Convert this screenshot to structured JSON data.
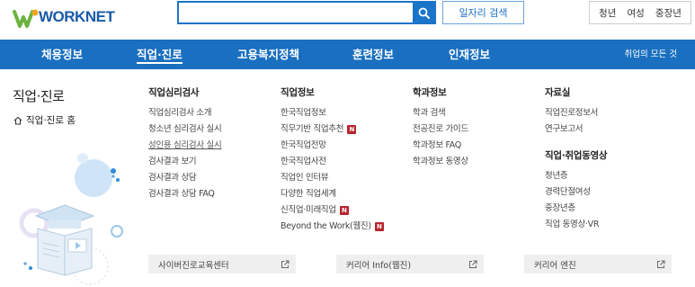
{
  "header": {
    "logo_text": "WORKNET",
    "search_placeholder": "",
    "job_search_label": "일자리 검색",
    "group_tabs": [
      "청년",
      "여성",
      "중장년"
    ]
  },
  "nav": {
    "items": [
      "채용정보",
      "직업·진로",
      "고용복지정책",
      "훈련정보",
      "인재정보"
    ],
    "active": "직업·진로",
    "all_label": "취업의 모든 것"
  },
  "side": {
    "title": "직업·진로",
    "home_label": "직업·진로 홈"
  },
  "columns": [
    {
      "heading": "직업심리검사",
      "items": [
        {
          "label": "직업심리검사 소개",
          "badge": false
        },
        {
          "label": "청소년 심리검사 실시",
          "badge": false
        },
        {
          "label": "성인용 심리검사 실시",
          "badge": false,
          "underlined": true
        },
        {
          "label": "검사결과 보기",
          "badge": false
        },
        {
          "label": "검사결과 상담",
          "badge": false
        },
        {
          "label": "검사결과 상담 FAQ",
          "badge": false
        }
      ]
    },
    {
      "heading": "직업정보",
      "items": [
        {
          "label": "한국직업정보",
          "badge": false
        },
        {
          "label": "직무기반 직업추천",
          "badge": true
        },
        {
          "label": "한국직업전망",
          "badge": false
        },
        {
          "label": "한국직업사전",
          "badge": false
        },
        {
          "label": "직업인 인터뷰",
          "badge": false
        },
        {
          "label": "다양한 직업세계",
          "badge": false
        },
        {
          "label": "신직업·미래직업",
          "badge": true
        },
        {
          "label": "Beyond the Work(웹진)",
          "badge": true
        }
      ]
    },
    {
      "heading": "학과정보",
      "items": [
        {
          "label": "학과 검색",
          "badge": false
        },
        {
          "label": "전공진로 가이드",
          "badge": false
        },
        {
          "label": "학과정보 FAQ",
          "badge": false
        },
        {
          "label": "학과정보 동영상",
          "badge": false
        }
      ]
    },
    {
      "heading": "자료실",
      "items": [
        {
          "label": "직업진로정보서",
          "badge": false
        },
        {
          "label": "연구보고서",
          "badge": false
        }
      ],
      "sub_heading": "직업·취업동영상",
      "sub_items": [
        {
          "label": "청년층",
          "badge": false
        },
        {
          "label": "경력단절여성",
          "badge": false
        },
        {
          "label": "중장년층",
          "badge": false
        },
        {
          "label": "직업 동영상·VR",
          "badge": false
        }
      ]
    }
  ],
  "badge_text": "N",
  "bottom_links": [
    "사이버진로교육센터",
    "커리어 Info(웹진)",
    "커리어 엔진"
  ],
  "colors": {
    "nav_bg": "#1a6fc0",
    "search_border": "#1b74c8",
    "badge_red": "#b8232f",
    "logo_blue": "#1a5aa8",
    "logo_green": "#6db33f"
  },
  "icons": [
    "search-icon",
    "home-icon",
    "external-link-icon"
  ]
}
